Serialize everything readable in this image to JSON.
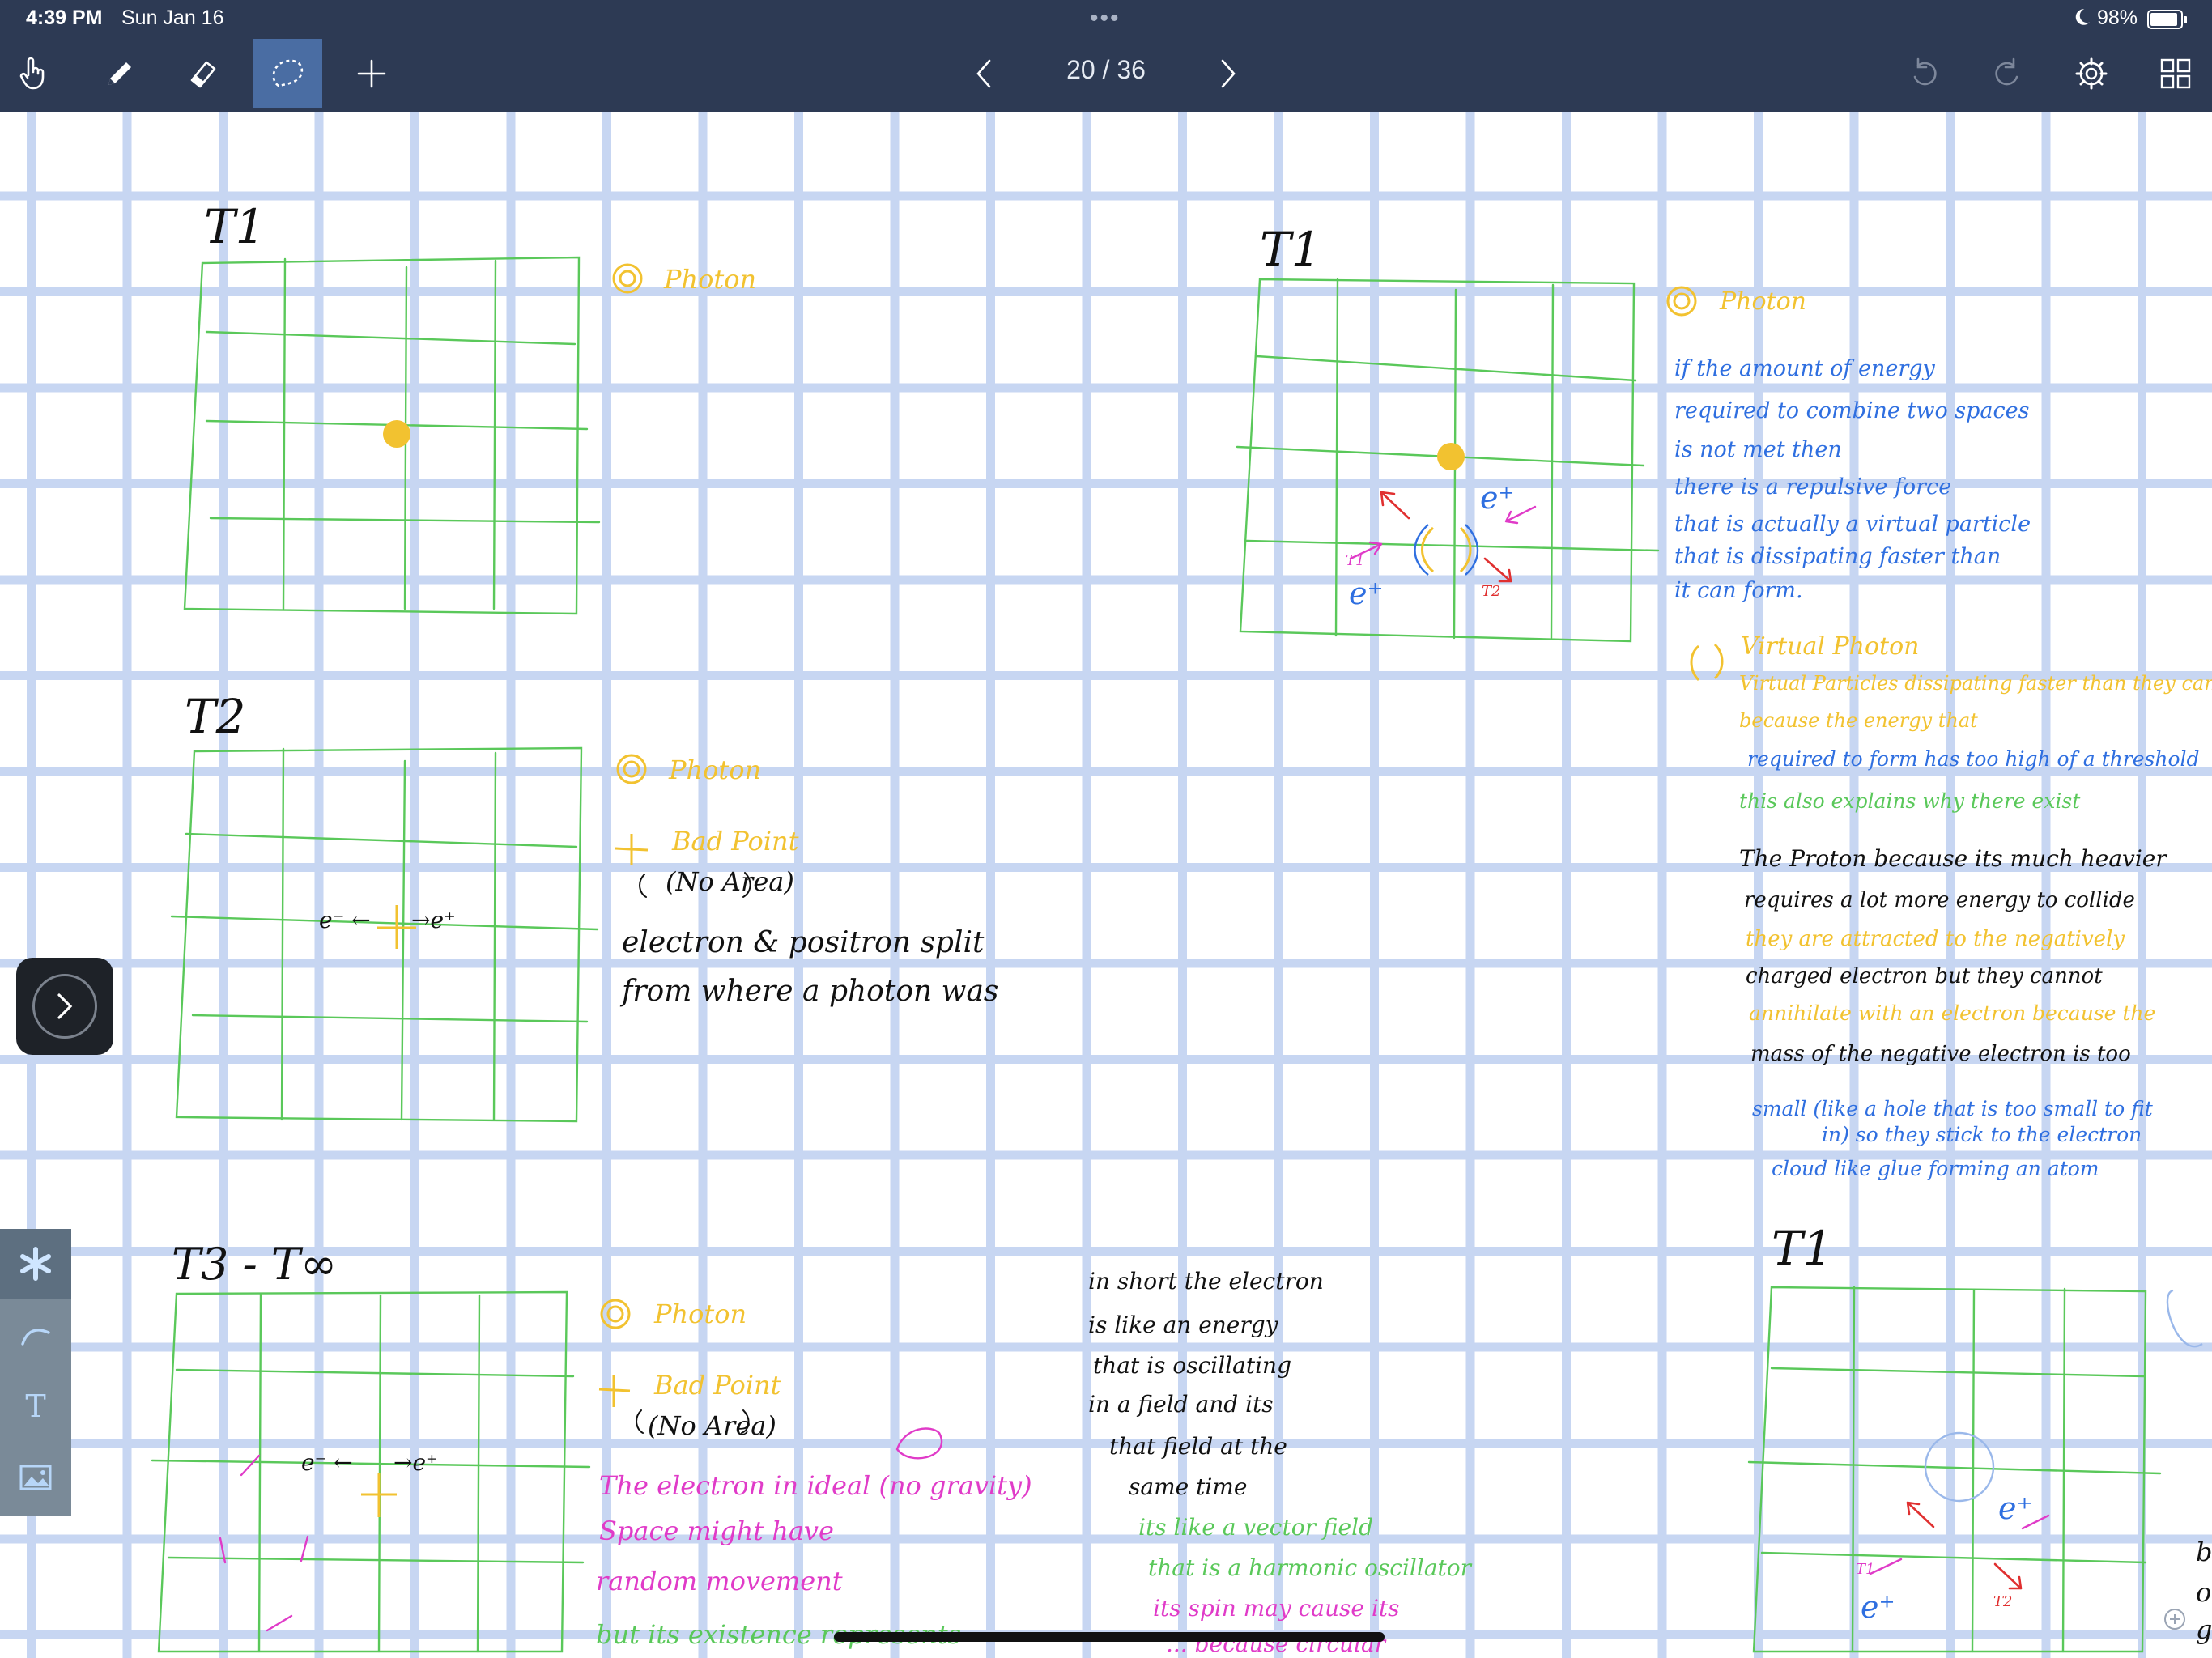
{
  "status_bar": {
    "time": "4:39 PM",
    "date": "Sun Jan 16",
    "dots": "•••",
    "battery_percent": "98%",
    "battery_level": 0.98
  },
  "toolbar": {
    "tools": [
      {
        "name": "hand-icon"
      },
      {
        "name": "pen-icon"
      },
      {
        "name": "eraser-icon"
      },
      {
        "name": "lasso-icon",
        "active": true
      },
      {
        "name": "plus-icon"
      }
    ],
    "page_indicator": "20 / 36",
    "current_page": 20,
    "total_pages": 36
  },
  "colors": {
    "toolbar_bg": "#2d3a54",
    "grid": "#c7d6f2",
    "frame_green": "#5ac85a",
    "photon_yellow": "#f2c230",
    "note_blue": "#2f6fe0",
    "note_pink": "#e03bc8",
    "arrow_red": "#e03030"
  },
  "notes": {
    "t1_label": "T1",
    "t1_photon_legend": "Photon",
    "t2_label": "T2",
    "t2_photon_legend": "Photon",
    "t2_badpoint_legend": "Bad Point",
    "t2_noarea": "(No Area)",
    "t2_e_minus": "e⁻ ←",
    "t2_e_plus": "→e⁺",
    "t2_line1": "electron & positron split",
    "t2_line2": "from where a photon was",
    "t3_label": "T3 - T∞",
    "t3_photon_legend": "Photon",
    "t3_badpoint_legend": "Bad Point",
    "t3_noarea": "(No Area)",
    "t3_e_minus": "e⁻ ←",
    "t3_e_plus": "→e⁺",
    "t3_pink_1": "The electron in ideal (no gravity)",
    "t3_pink_2": "Space might have",
    "t3_pink_3": "random movement",
    "t3_green_4": "but its existence represents",
    "mid_1": "in short the electron",
    "mid_2": "is like an energy",
    "mid_3": "that is oscillating",
    "mid_4": "in a field and its",
    "mid_5": "that field at the",
    "mid_6": "same time",
    "mid_green_1": "its like a vector field",
    "mid_green_2": "that is a harmonic oscillator",
    "mid_pink_1": "its spin may cause its",
    "mid_pink_2": "... because circular",
    "r_t1_label": "T1",
    "r_photon_legend": "Photon",
    "r_blue_1": "if the amount of energy",
    "r_blue_2": "required to combine two spaces",
    "r_blue_3": "is not met then",
    "r_blue_4": "there is a repulsive force",
    "r_blue_5": "that is actually a virtual particle",
    "r_blue_6": "that is dissipating faster than",
    "r_blue_7": "it can form.",
    "r_virtual_legend": "Virtual Photon",
    "r_vp_1": "Virtual Particles dissipating faster than they can form",
    "r_vp_2": "because the energy that",
    "r_vp_3": "required to form has too high of a threshold",
    "r_vp_4": "this also explains why there exist",
    "r_k_1": "The Proton because its much heavier",
    "r_k_2": "requires a lot more energy to collide",
    "r_k_3": "they are attracted to the negatively",
    "r_k_4": "charged electron but they cannot",
    "r_k_5": "annihilate with an electron because the",
    "r_k_6": "mass of the negative electron is too",
    "r_k_7": "small (like a hole that is too small to fit",
    "r_k_8": "in) so they stick to the electron",
    "r_k_9": "cloud like glue forming an atom",
    "r2_t1_label": "T1",
    "r_t1_sub": "T1",
    "r_t2_sub": "T2",
    "e_plus": "e⁺",
    "edge_1": "b",
    "edge_2": "o",
    "edge_3": "g"
  },
  "side_panel": {
    "toggle_icon": "chevron-right-icon",
    "palette": [
      {
        "name": "asterisk-icon",
        "active": true
      },
      {
        "name": "curve-icon"
      },
      {
        "name": "text-icon",
        "label": "T"
      },
      {
        "name": "image-icon"
      }
    ]
  }
}
